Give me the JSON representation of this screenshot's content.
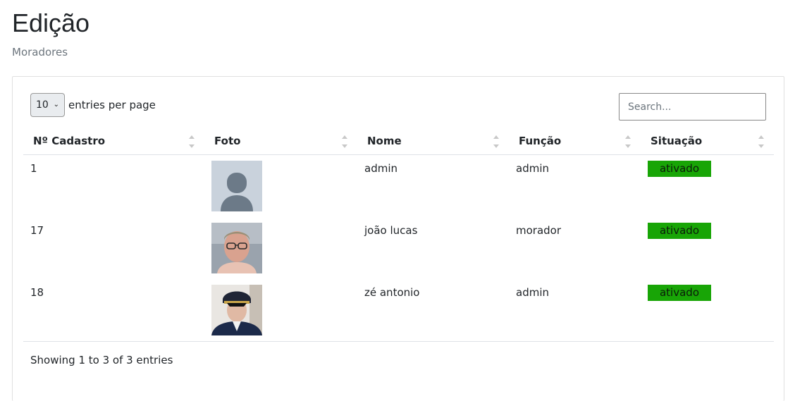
{
  "page": {
    "title": "Edição",
    "breadcrumb": "Moradores"
  },
  "table_controls": {
    "per_page_value": "10",
    "per_page_options": [
      "10"
    ],
    "per_page_label": "entries per page",
    "search_placeholder": "Search..."
  },
  "table": {
    "columns": [
      "Nº Cadastro",
      "Foto",
      "Nome",
      "Função",
      "Situação"
    ],
    "rows": [
      {
        "id": "1",
        "photo": "default-avatar",
        "name": "admin",
        "role": "admin",
        "status": "ativado"
      },
      {
        "id": "17",
        "photo": "user-photo-joao",
        "name": "joão lucas",
        "role": "morador",
        "status": "ativado"
      },
      {
        "id": "18",
        "photo": "user-photo-ze",
        "name": "zé antonio",
        "role": "admin",
        "status": "ativado"
      }
    ],
    "info": "Showing 1 to 3 of 3 entries"
  },
  "colors": {
    "status_active": "#18a506"
  }
}
